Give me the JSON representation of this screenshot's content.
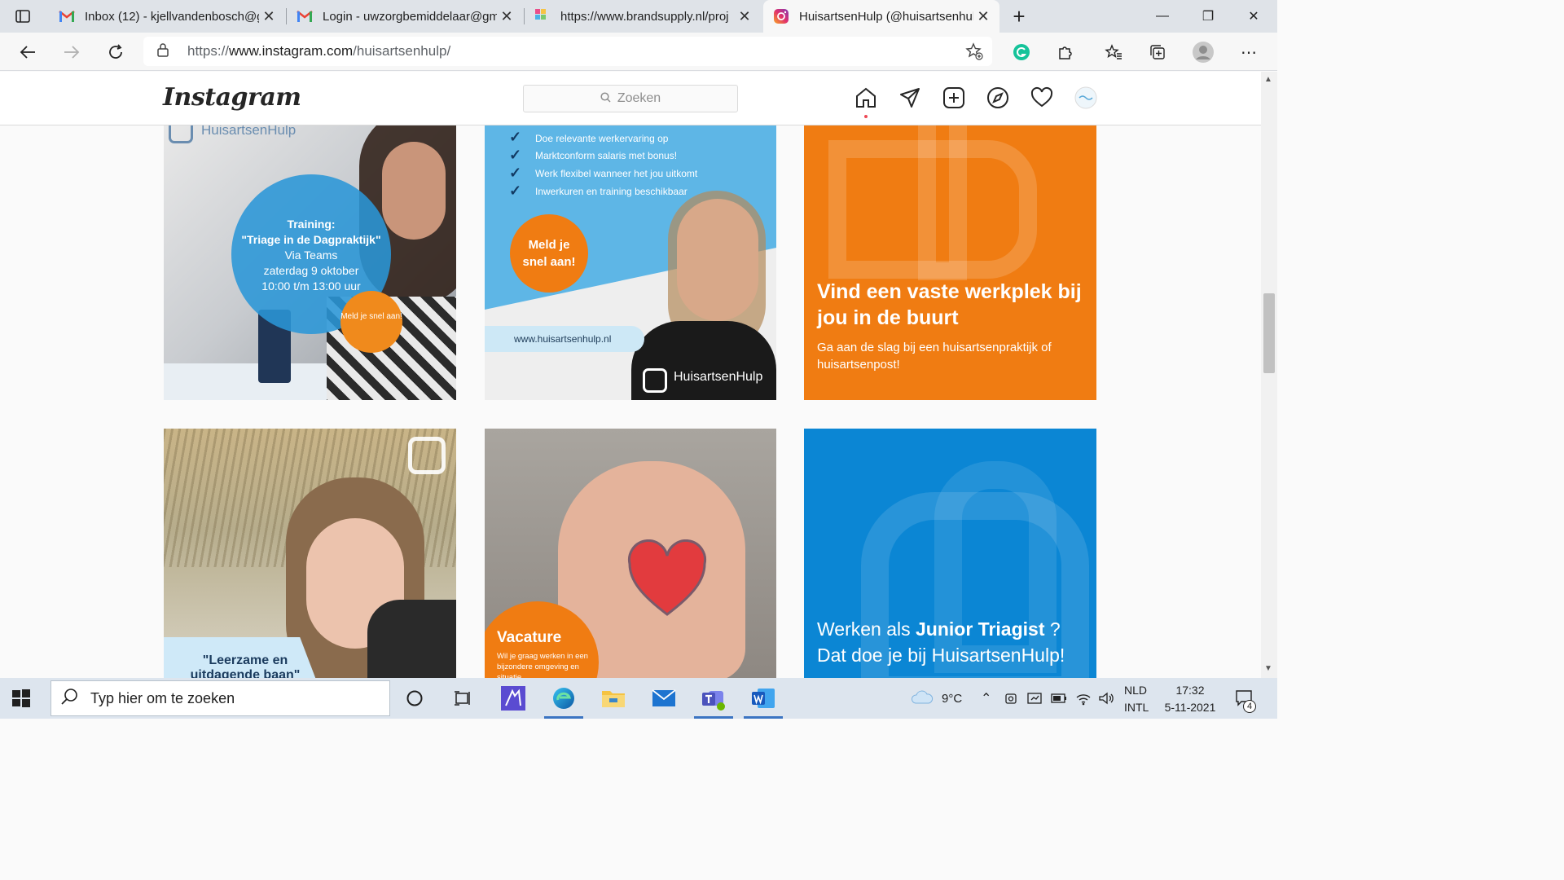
{
  "browser": {
    "tabs": [
      {
        "title": "Inbox (12) - kjellvandenbosch@g",
        "icon": "gmail-icon"
      },
      {
        "title": "Login - uwzorgbemiddelaar@gm",
        "icon": "gmail-icon"
      },
      {
        "title": "https://www.brandsupply.nl/proj",
        "icon": "brandsupply-icon"
      },
      {
        "title": "HuisartsenHulp (@huisartsenhul",
        "icon": "instagram-icon"
      }
    ],
    "close_glyph": "✕",
    "new_tab_glyph": "+",
    "window": {
      "minimize": "—",
      "restore": "❐",
      "close": "✕"
    },
    "address": {
      "prefix": "https://",
      "host": "www.instagram.com",
      "path": "/huisartsenhulp/"
    }
  },
  "instagram": {
    "logo": "Instagram",
    "search_placeholder": "Zoeken"
  },
  "posts": {
    "p1": {
      "logo_text": "HuisartsenHulp",
      "title_line1": "Training:",
      "title_line2": "\"Triage in de Dagpraktijk\"",
      "line3": "Via Teams",
      "line4": "zaterdag 9 oktober",
      "line5": "10:00 t/m 13:00 uur",
      "cta": "Meld je snel aan!"
    },
    "p2": {
      "items": [
        "Doe relevante werkervaring op",
        "Marktconform salaris met bonus!",
        "Werk flexibel wanneer het jou uitkomt",
        "Inwerkuren en training beschikbaar"
      ],
      "cta_line1": "Meld je",
      "cta_line2": "snel aan!",
      "url": "www.huisartsenhulp.nl",
      "brand": "HuisartsenHulp"
    },
    "p3": {
      "heading": "Vind een vaste werkplek bij jou in de buurt",
      "sub": "Ga aan de slag bij een huisartsenpraktijk of huisartsenpost!"
    },
    "p4": {
      "quote": "\"Leerzame en uitdagende baan\""
    },
    "p5": {
      "title": "Vacature",
      "sub": "Wil je graag werken in een bijzondere omgeving en situatie"
    },
    "p6": {
      "line1_pre": "Werken als ",
      "line1_bold": "Junior Triagist",
      "line1_post": " ?",
      "line2": "Dat doe je bij HuisartsenHulp!"
    }
  },
  "taskbar": {
    "search_placeholder": "Typ hier om te zoeken",
    "weather": "9°C",
    "lang1": "NLD",
    "lang2": "INTL",
    "time": "17:32",
    "date": "5-11-2021",
    "notifications": "4"
  }
}
